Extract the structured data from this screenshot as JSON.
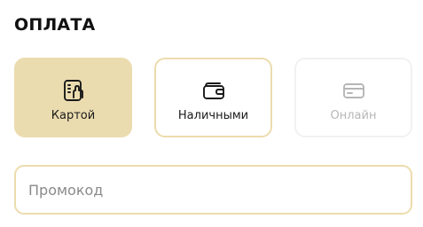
{
  "payment": {
    "title": "ОПЛАТА",
    "options": [
      {
        "label": "Картой",
        "icon": "card-tap-icon",
        "state": "selected"
      },
      {
        "label": "Наличными",
        "icon": "wallet-icon",
        "state": "default"
      },
      {
        "label": "Онлайн",
        "icon": "credit-card-icon",
        "state": "disabled"
      }
    ],
    "promo": {
      "placeholder": "Промокод",
      "value": ""
    }
  },
  "colors": {
    "selected_bg": "#ebdcb0",
    "border_accent": "#ecdcad",
    "disabled_text": "#b6b6b6",
    "text": "#111111"
  }
}
